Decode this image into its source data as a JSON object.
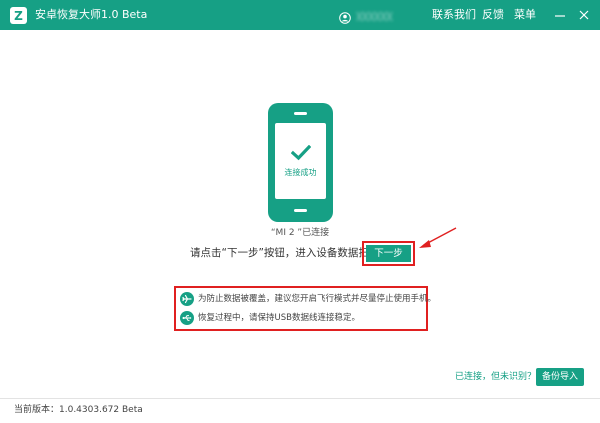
{
  "titlebar": {
    "app_title": "安卓恢复大师1.0 Beta",
    "app_icon_letter": "Z",
    "user_name": "ꭓꭓꭓꭓꭓꭓ",
    "menu": {
      "contact": "联系我们",
      "feedback": "反馈",
      "menu": "菜单"
    },
    "colors": {
      "bar": "#16a085",
      "text": "#ffffff"
    }
  },
  "phone": {
    "status_text": "连接成功",
    "color": "#16a085"
  },
  "device": {
    "line": "“MI 2 ”已连接"
  },
  "instruction": {
    "text": "请点击“下一步”按钮，进入设备数据扫描",
    "next_button": "下一步"
  },
  "tips": [
    {
      "icon": "airplane-icon",
      "text": "为防止数据被覆盖，建议您开启飞行模式并尽量停止使用手机。"
    },
    {
      "icon": "usb-icon",
      "text": "恢复过程中，请保持USB数据线连接稳定。"
    }
  ],
  "bottom": {
    "unrecognized_link": "已连接，但未识别？",
    "backup_import_button": "备份导入",
    "version": "当前版本：1.0.4303.672 Beta"
  },
  "colors": {
    "accent": "#16a085",
    "highlight": "#e02020"
  }
}
